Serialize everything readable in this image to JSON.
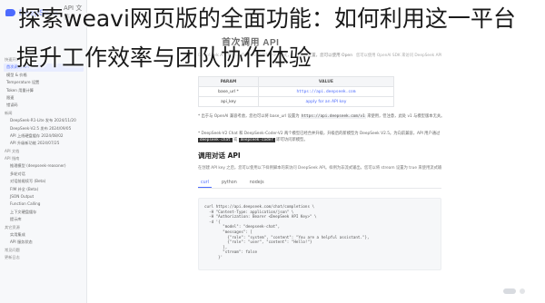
{
  "overlay": {
    "line1": "探索weavi网页版的全面功能：如何利用这一平台",
    "line2": "提升工作效率与团队协作体验"
  },
  "sidebar": {
    "brand": "DeepSeek",
    "brand_suffix": "API 文档",
    "items": [
      {
        "label": "快速开始",
        "level": "section"
      },
      {
        "label": "首次调用 API",
        "level": "item",
        "active": true
      },
      {
        "label": "模型 & 价格",
        "level": "item"
      },
      {
        "label": "Temperature 设置",
        "level": "item"
      },
      {
        "label": "Token 用量计算",
        "level": "item"
      },
      {
        "label": "限速",
        "level": "item"
      },
      {
        "label": "错误码",
        "level": "item"
      },
      {
        "label": "新闻",
        "level": "section"
      },
      {
        "label": "DeepSeek-R1-Lite 发布 2024/11/20",
        "level": "sub"
      },
      {
        "label": "DeepSeek-V2.5 发布 2024/09/05",
        "level": "sub"
      },
      {
        "label": "API 上线硬盘缓存 2024/08/02",
        "level": "sub"
      },
      {
        "label": "API 升级新功能 2024/07/25",
        "level": "sub"
      },
      {
        "label": "API 文档",
        "level": "section"
      },
      {
        "label": "API 指南",
        "level": "section"
      },
      {
        "label": "推理模型 (deepseek-reasoner)",
        "level": "sub"
      },
      {
        "label": "多轮对话",
        "level": "sub"
      },
      {
        "label": "对话前缀续写 (Beta)",
        "level": "sub"
      },
      {
        "label": "FIM 补全 (Beta)",
        "level": "sub"
      },
      {
        "label": "JSON Output",
        "level": "sub"
      },
      {
        "label": "Function Calling",
        "level": "sub"
      },
      {
        "label": "上下文硬盘缓存",
        "level": "sub"
      },
      {
        "label": "提示库",
        "level": "sub"
      },
      {
        "label": "其它资源",
        "level": "section"
      },
      {
        "label": "实用集成",
        "level": "sub"
      },
      {
        "label": "API 服务状态",
        "level": "sub"
      },
      {
        "label": "常见问题",
        "level": "section"
      },
      {
        "label": "更新日志",
        "level": "section"
      }
    ]
  },
  "main": {
    "title": "首次调用 API",
    "intro": "DeepSeek API 使用与 OpenAI 兼容的 API 格式，通过修改配置，您可以使用 OpenAI SDK 来访问 DeepSeek API。",
    "header_faint": "您可以使用 OpenAI SDK 来访问 DeepSeek API",
    "table": {
      "headers": [
        "PARAM",
        "VALUE"
      ],
      "rows": [
        {
          "param": "base_url *",
          "value": "https://api.deepseek.com"
        },
        {
          "param": "api_key",
          "value": "apply for an API key"
        }
      ]
    },
    "note1_prefix": "* 出于与 OpenAI 兼容考虑，您也可以将 base_url 设置为",
    "note1_code": "https://api.deepseek.com/v1",
    "note1_suffix": "来使用，但注意，此处 v1 与模型版本无关。",
    "note2_prefix": "* DeepSeek-V2 Chat 和 DeepSeek-Coder-V2 两个模型已经合并升级，升级后的新模型为 DeepSeek V2.5。为向前兼容，API 用户通过",
    "note2_code1": "deepseek-chat",
    "note2_mid": "或",
    "note2_code2": "deepseek-coder",
    "note2_suffix": "即可访问新模型。",
    "section_title": "调用对话 API",
    "section_desc": "在创建 API key 之后，您可以使用以下样例脚本的来访问 DeepSeek API。样例为非流式输出，您可以将 stream 设置为 true 来使用流式输出。",
    "tabs": [
      "curl",
      "python",
      "nodejs"
    ],
    "active_tab": "curl",
    "code": [
      "curl https://api.deepseek.com/chat/completions \\",
      "  -H \"Content-Type: application/json\" \\",
      "  -H \"Authorization: Bearer <DeepSeek API Key>\" \\",
      "  -d '{",
      "        \"model\": \"deepseek-chat\",",
      "        \"messages\": [",
      "          {\"role\": \"system\", \"content\": \"You are a helpful assistant.\"},",
      "          {\"role\": \"user\", \"content\": \"Hello!\"}",
      "        ],",
      "        \"stream\": false",
      "      }'"
    ]
  },
  "colors": {
    "accent": "#4d6bfe",
    "sidebar_bg": "#f7f8fa"
  }
}
